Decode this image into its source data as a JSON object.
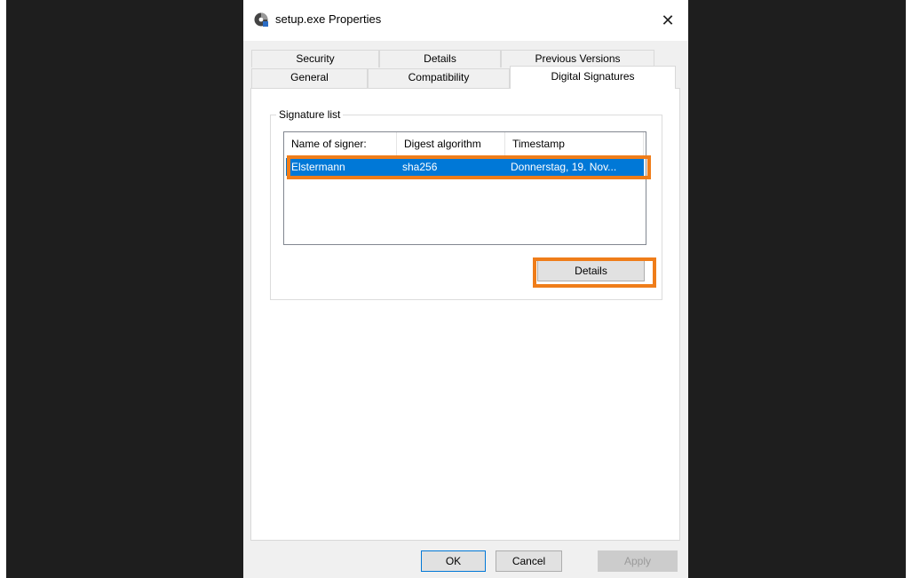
{
  "dialog": {
    "title": "setup.exe Properties",
    "close_symbol": "✕"
  },
  "tabs": {
    "row1": [
      "Security",
      "Details",
      "Previous Versions"
    ],
    "row2": [
      "General",
      "Compatibility",
      "Digital Signatures"
    ],
    "active": "Digital Signatures"
  },
  "signature_list": {
    "group_label": "Signature list",
    "columns": [
      "Name of signer:",
      "Digest algorithm",
      "Timestamp"
    ],
    "rows": [
      {
        "signer": "Elstermann",
        "digest": "sha256",
        "timestamp": "Donnerstag, 19. Nov..."
      }
    ],
    "details_button": "Details"
  },
  "buttons": {
    "ok": "OK",
    "cancel": "Cancel",
    "apply": "Apply"
  },
  "colors": {
    "selection": "#0078d7",
    "highlight": "#ef7d1a"
  },
  "icons": {
    "app": "setup-disc-icon",
    "close": "close-icon"
  }
}
